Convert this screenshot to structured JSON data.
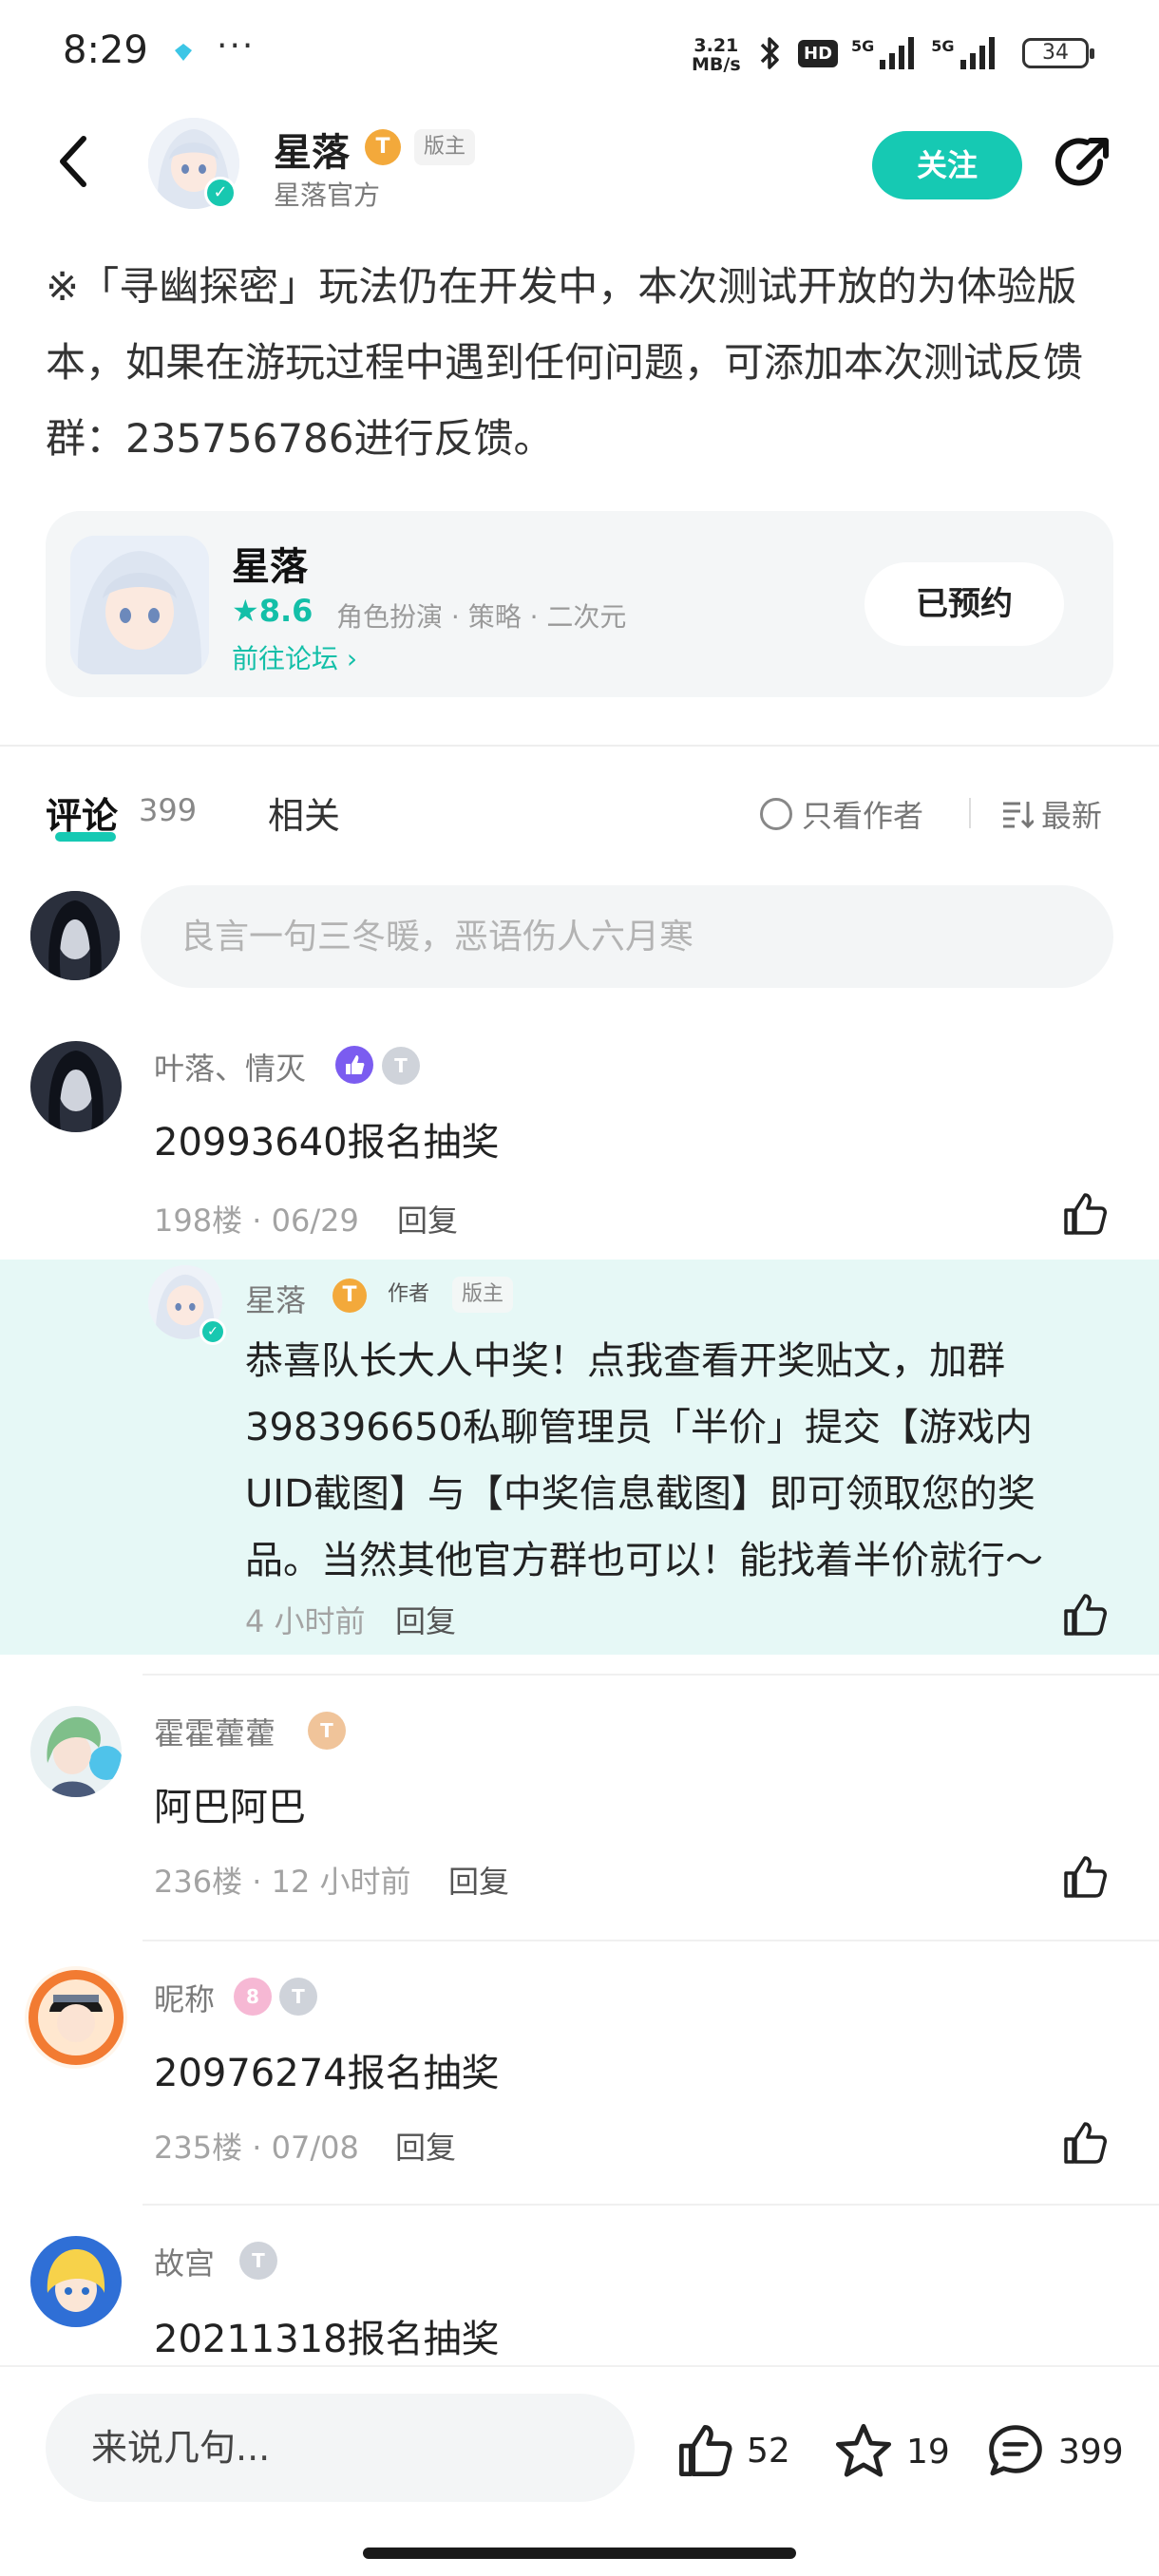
{
  "status_bar": {
    "time": "8:29",
    "more": "···",
    "net_speed_value": "3.21",
    "net_speed_unit": "MB/s",
    "hd_badge": "HD",
    "signal1": "5G",
    "signal2": "5G",
    "battery": "34"
  },
  "header": {
    "name": "星落",
    "level_badge": "T",
    "role_tag": "版主",
    "subtitle": "星落官方",
    "follow_label": "关注"
  },
  "post": {
    "text": "※「寻幽探密」玩法仍在开发中，本次测试开放的为体验版本，如果在游玩过程中遇到任何问题，可添加本次测试反馈群：235756786进行反馈。"
  },
  "game_card": {
    "name": "星落",
    "rating": "8.6",
    "tags": "角色扮演 · 策略 · 二次元",
    "forum_link": "前往论坛",
    "reserve_label": "已预约"
  },
  "tabs": {
    "comments_label": "评论",
    "comments_count": "399",
    "related_label": "相关",
    "author_only_label": "只看作者",
    "sort_label": "最新"
  },
  "comment_box": {
    "placeholder": "良言一句三冬暖，恶语伤人六月寒"
  },
  "comments": [
    {
      "name": "叶落、情灭",
      "text": "20993640报名抽奖",
      "floor": "198楼",
      "date": "06/29",
      "reply_label": "回复",
      "level": "T"
    },
    {
      "name": "霍霍藿藿",
      "text": "阿巴阿巴",
      "floor": "236楼",
      "date": "12 小时前",
      "reply_label": "回复",
      "level": "T"
    },
    {
      "name": "昵称",
      "text": "20976274报名抽奖",
      "floor": "235楼",
      "date": "07/08",
      "reply_label": "回复",
      "level": "T",
      "badge8": "8"
    },
    {
      "name": "故宫",
      "text": "20211318报名抽奖",
      "level": "T"
    }
  ],
  "author_reply": {
    "name": "星落",
    "level_badge": "T",
    "author_tag": "作者",
    "role_tag": "版主",
    "text": "恭喜队长大人中奖！点我查看开奖贴文，加群398396650私聊管理员「半价」提交【游戏内UID截图】与【中奖信息截图】即可领取您的奖品。当然其他官方群也可以！能找着半价就行～",
    "time": "4 小时前",
    "reply_label": "回复"
  },
  "bottom_bar": {
    "input_placeholder": "来说几句...",
    "likes": "52",
    "favorites": "19",
    "comments": "399"
  },
  "colors": {
    "accent": "#16c9b3",
    "reply_bg": "#e6f8f6",
    "level_gold": "#f3a93b"
  }
}
